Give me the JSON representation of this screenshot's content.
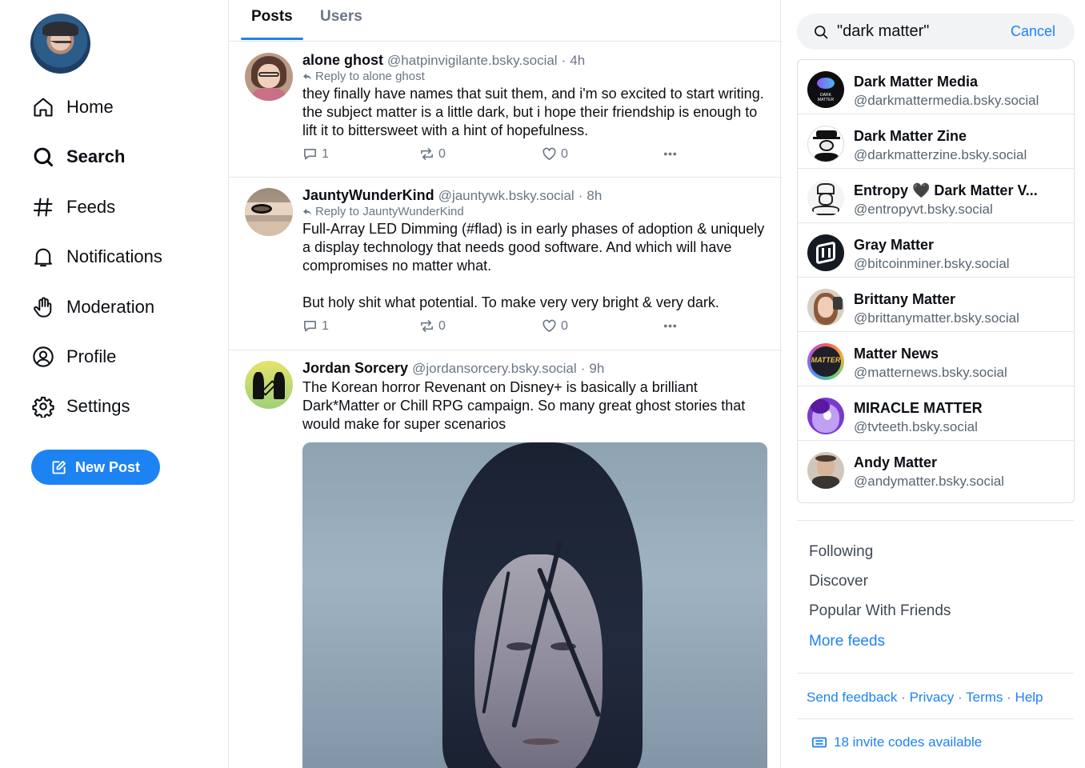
{
  "nav": {
    "items": [
      {
        "label": "Home",
        "icon": "home-icon"
      },
      {
        "label": "Search",
        "icon": "search-icon"
      },
      {
        "label": "Feeds",
        "icon": "hashtag-icon"
      },
      {
        "label": "Notifications",
        "icon": "bell-icon"
      },
      {
        "label": "Moderation",
        "icon": "hand-icon"
      },
      {
        "label": "Profile",
        "icon": "user-circle-icon"
      },
      {
        "label": "Settings",
        "icon": "gear-icon"
      }
    ],
    "active": "Search",
    "new_post_label": "New Post"
  },
  "tabs": [
    {
      "label": "Posts",
      "active": true
    },
    {
      "label": "Users",
      "active": false
    }
  ],
  "posts": [
    {
      "name": "alone ghost",
      "handle": "@hatpinvigilante.bsky.social",
      "time": "4h",
      "reply_to": "Reply to alone ghost",
      "text": "they finally have names that suit them, and i'm so excited to start writing. the subject matter is a little dark, but i hope their friendship is enough to lift it to bittersweet with a hint of hopefulness.",
      "replies": "1",
      "reposts": "0",
      "likes": "0"
    },
    {
      "name": "JauntyWunderKind",
      "handle": "@jauntywk.bsky.social",
      "time": "8h",
      "reply_to": "Reply to JauntyWunderKind",
      "text": "Full-Array LED Dimming (#flad) is in early phases of adoption & uniquely a display technology that needs good software. And which will have compromises no matter what.\n\nBut holy shit what potential. To make very very bright & very dark.",
      "replies": "1",
      "reposts": "0",
      "likes": "0"
    },
    {
      "name": "Jordan Sorcery",
      "handle": "@jordansorcery.bsky.social",
      "time": "9h",
      "text": "The Korean horror Revenant on Disney+ is basically a brilliant Dark*Matter or Chill RPG campaign. So many great ghost stories that would make for super scenarios"
    }
  ],
  "search": {
    "query": "\"dark matter\"",
    "cancel_label": "Cancel"
  },
  "results": [
    {
      "name": "Dark Matter Media",
      "handle": "@darkmattermedia.bsky.social",
      "avatar_text": "DARK MATTER"
    },
    {
      "name": "Dark Matter Zine",
      "handle": "@darkmatterzine.bsky.social"
    },
    {
      "name": "Entropy 🖤 Dark Matter V...",
      "handle": "@entropyvt.bsky.social"
    },
    {
      "name": "Gray Matter",
      "handle": "@bitcoinminer.bsky.social"
    },
    {
      "name": "Brittany Matter",
      "handle": "@brittanymatter.bsky.social"
    },
    {
      "name": "Matter News",
      "handle": "@matternews.bsky.social",
      "avatar_text": "MATTER"
    },
    {
      "name": "MIRACLE MATTER",
      "handle": "@tvteeth.bsky.social"
    },
    {
      "name": "Andy Matter",
      "handle": "@andymatter.bsky.social"
    }
  ],
  "feeds": {
    "items": [
      "Following",
      "Discover",
      "Popular With Friends"
    ],
    "more_label": "More feeds"
  },
  "footer": {
    "links": [
      "Send feedback",
      "Privacy",
      "Terms",
      "Help"
    ],
    "separator": "·",
    "invite_label": "18 invite codes available"
  },
  "colors": {
    "accent": "#1d83f3",
    "muted": "#6b7684",
    "border": "#e4e7eb"
  }
}
